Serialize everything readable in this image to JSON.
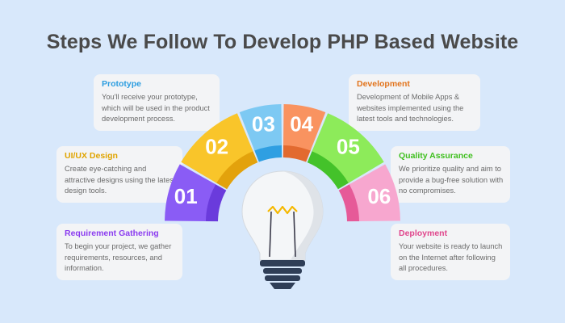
{
  "title": "Steps We Follow To Develop PHP Based Website",
  "steps": [
    {
      "number": "01",
      "title": "Requirement Gathering",
      "title_color": "#8b3cf0",
      "color": "#8a5cf5",
      "shade": "#6a3bdc",
      "desc": "To begin your project, we gather requirements, resources, and information."
    },
    {
      "number": "02",
      "title": "UI/UX Design",
      "title_color": "#e0a400",
      "color": "#f9c52a",
      "shade": "#e3a20c",
      "desc": "Create eye-catching and attractive designs using the latest design tools."
    },
    {
      "number": "03",
      "title": "Prototype",
      "title_color": "#2c9de0",
      "color": "#7dc9f3",
      "shade": "#2f9fe2",
      "desc": "You'll receive your prototype, which will be used in the product development process."
    },
    {
      "number": "04",
      "title": "Development",
      "title_color": "#e2731b",
      "color": "#f99360",
      "shade": "#e26a2f",
      "desc": "Development of Mobile Apps & websites implemented using the latest tools and technologies."
    },
    {
      "number": "05",
      "title": "Quality Assurance",
      "title_color": "#3fbf1f",
      "color": "#8deb5a",
      "shade": "#44c22a",
      "desc": "We prioritize quality and aim to provide a bug-free solution with no compromises."
    },
    {
      "number": "06",
      "title": "Deployment",
      "title_color": "#e0468c",
      "color": "#f7a7cf",
      "shade": "#e65a98",
      "desc": "Your website is ready to launch on the Internet after following all procedures."
    }
  ]
}
